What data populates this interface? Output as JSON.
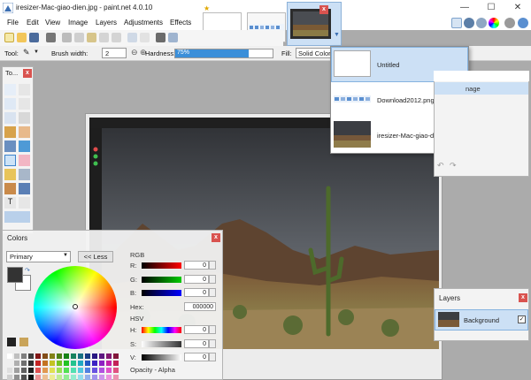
{
  "window": {
    "title": "iresizer-Mac-giao-dien.jpg - paint.net 4.0.10",
    "minimize": "—",
    "maximize": "☐",
    "close": "✕"
  },
  "menu": [
    "File",
    "Edit",
    "View",
    "Image",
    "Layers",
    "Adjustments",
    "Effects"
  ],
  "tool_options": {
    "tool_label": "Tool:",
    "brush_width_label": "Brush width:",
    "brush_width_value": "2",
    "hardness_label": "Hardness:",
    "hardness_value": "75%",
    "hardness_fraction": 0.75,
    "fill_label": "Fill:",
    "fill_value": "Solid Color"
  },
  "tools_panel": {
    "title": "To...",
    "close": "x"
  },
  "image_list": {
    "items": [
      {
        "name": "Untitled",
        "selected": true
      },
      {
        "name": "Download2012.png",
        "selected": false
      },
      {
        "name": "iresizer-Mac-giao-dien.jpg",
        "selected": false
      }
    ]
  },
  "history_panel": {
    "selected_tail": "nage"
  },
  "colors_panel": {
    "title": "Colors",
    "close": "x",
    "mode_select": "Primary",
    "less_button": "<< Less",
    "rgb_header": "RGB",
    "r_label": "R:",
    "g_label": "G:",
    "b_label": "B:",
    "r_value": "0",
    "g_value": "0",
    "b_value": "0",
    "hex_label": "Hex:",
    "hex_value": "000000",
    "hsv_header": "HSV",
    "h_label": "H:",
    "s_label": "S:",
    "v_label": "V:",
    "h_value": "0",
    "s_value": "0",
    "v_value": "0",
    "opacity_label": "Opacity - Alpha"
  },
  "layers_panel": {
    "title": "Layers",
    "close": "x",
    "layer_name": "Background",
    "layer_visible_mark": "✓"
  },
  "colors": {
    "accent": "#3b8fd9",
    "selection": "#cce0f5",
    "close_red": "#d9534f"
  }
}
